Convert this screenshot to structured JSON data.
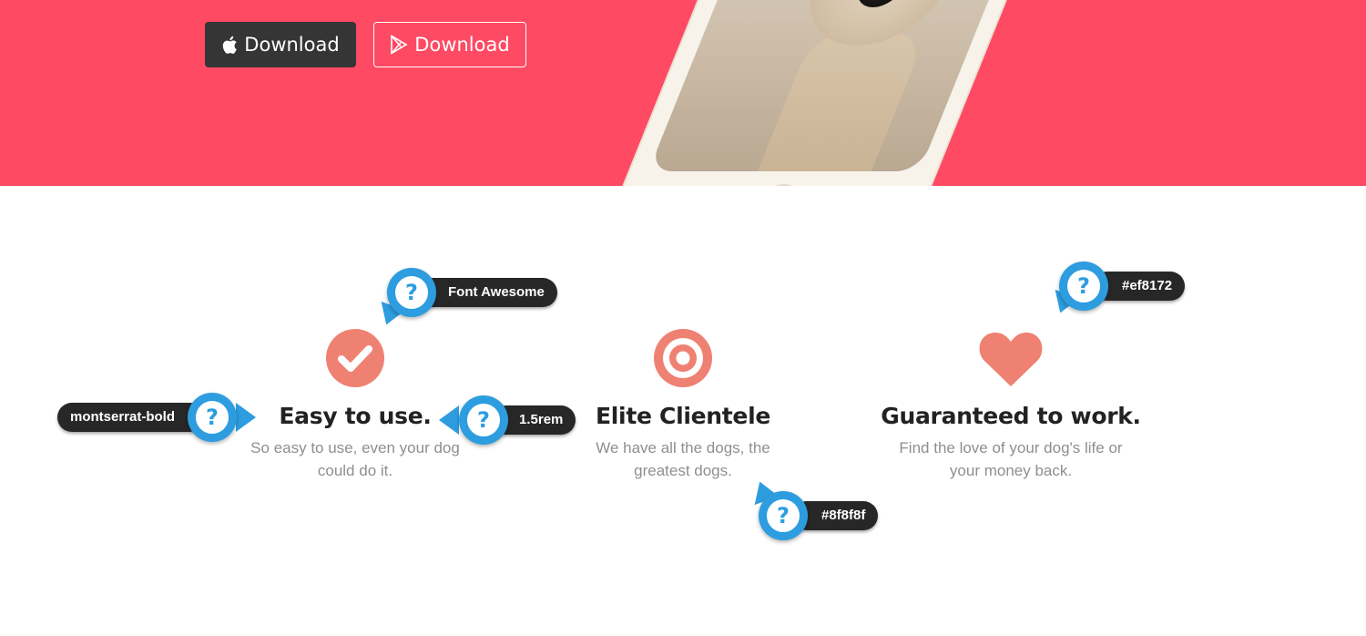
{
  "hero": {
    "bg_color": "#ff4a63",
    "buttons": [
      {
        "label": "Download",
        "icon": "apple-icon",
        "style": "dark"
      },
      {
        "label": "Download",
        "icon": "google-play-icon",
        "style": "outline"
      }
    ]
  },
  "features": [
    {
      "icon": "check-circle-icon",
      "title": "Easy to use.",
      "description": "So easy to use, even your dog could do it."
    },
    {
      "icon": "bullseye-icon",
      "title": "Elite Clientele",
      "description": "We have all the dogs, the greatest dogs."
    },
    {
      "icon": "heart-icon",
      "title": "Guaranteed to work.",
      "description": "Find the love of your dog's life or your money back."
    }
  ],
  "icon_color": "#ef8172",
  "annotations": [
    {
      "text": "Font Awesome"
    },
    {
      "text": "montserrat-bold"
    },
    {
      "text": "1.5rem"
    },
    {
      "text": "#ef8172"
    },
    {
      "text": "#8f8f8f"
    }
  ],
  "annotation_color": "#2d9de0"
}
